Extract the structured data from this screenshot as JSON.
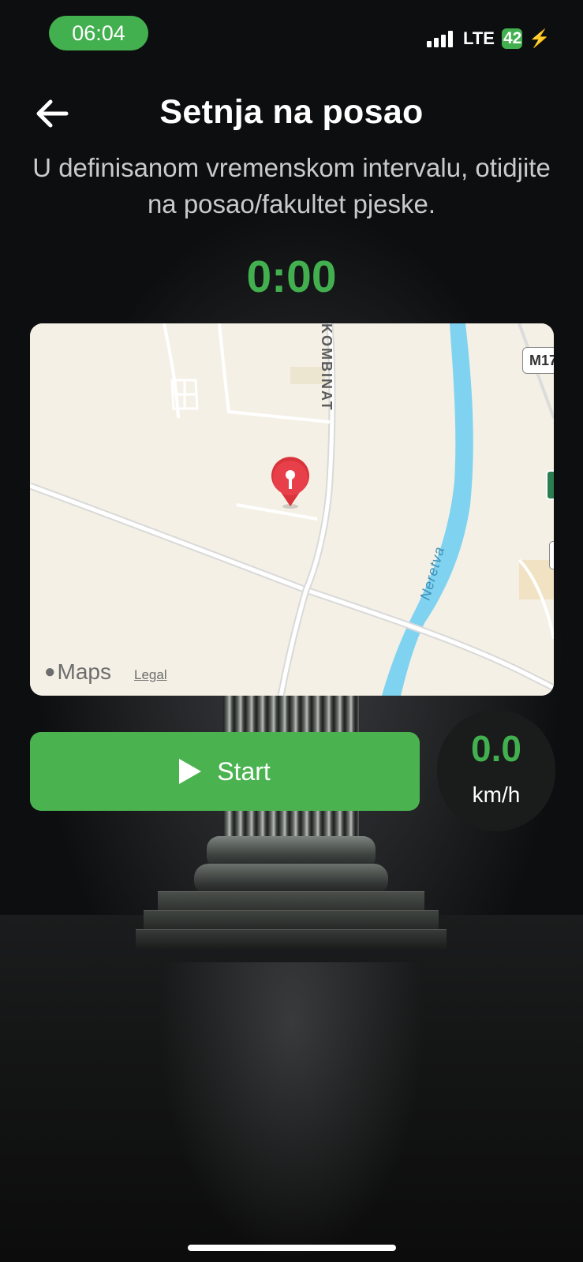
{
  "status_bar": {
    "time": "06:04",
    "network": "LTE",
    "battery_level": "42",
    "charging": true,
    "accent_color": "#43b04f"
  },
  "header": {
    "back_icon": "arrow-left-icon",
    "title": "Setnja na posao"
  },
  "description": "U definisanom vremenskom intervalu, otidjite na posao/fakultet pjeske.",
  "timer": "0:00",
  "map": {
    "attribution": "Maps",
    "legal": "Legal",
    "road_label": "KOMBINAT",
    "route_shield": "M17",
    "river_label": "Neretva",
    "pin_icon": "map-pin-icon"
  },
  "controls": {
    "start_label": "Start",
    "start_icon": "play-icon",
    "speed_value": "0.0",
    "speed_unit": "km/h",
    "button_color": "#4ab350"
  }
}
